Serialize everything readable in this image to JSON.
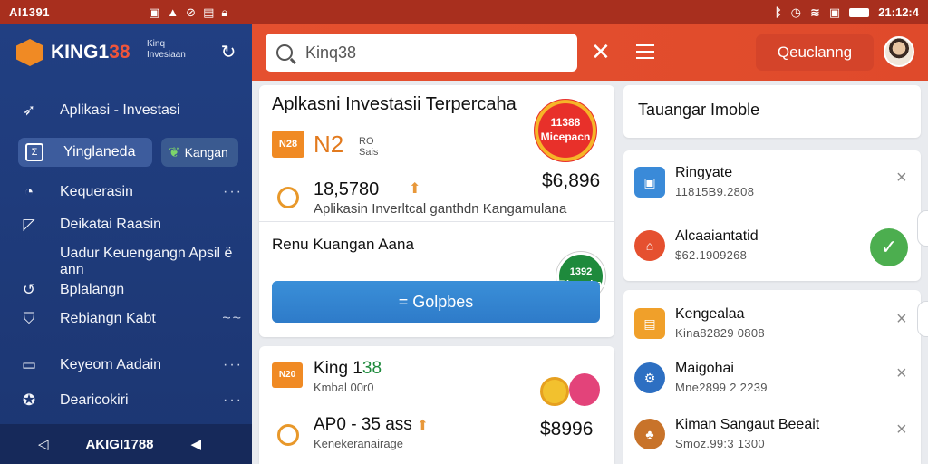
{
  "status_bar": {
    "left": "AI1391",
    "mid_icons": [
      "image-icon",
      "upload-icon",
      "link-icon",
      "sim-icon",
      "lock-icon"
    ],
    "right": "21:12:4"
  },
  "sidebar": {
    "brand_name_a": "KING1",
    "brand_name_b": "38",
    "brand_tag": "Kinq\nInvesiaan",
    "items": [
      {
        "label": "Aplikasi - Investasi",
        "icon": "compass-icon"
      },
      {
        "label": "Kequerasin",
        "icon": "clock-icon",
        "more": "···"
      },
      {
        "label": "Deikatai Raasin",
        "icon": "chart-icon"
      },
      {
        "label": "Bplalangn",
        "icon": "refresh-icon"
      },
      {
        "label": "Rebiangn Kabt",
        "icon": "shield-icon",
        "more": "~~"
      },
      {
        "label": "Keyeom Aadain",
        "icon": "wallet-icon",
        "more": "···"
      },
      {
        "label": "Dearicokiri",
        "icon": "star-icon",
        "more": "···"
      }
    ],
    "subline": "Uadur Keuengangn Apsil ë ann",
    "active_pill": "Yinglaneda",
    "green_pill": "Kangan",
    "bottom_label": "AKIGI1788"
  },
  "header": {
    "search_value": "Kinq38",
    "search_placeholder": "Search",
    "action_button": "Qeuclanng"
  },
  "main_card": {
    "title": "Aplkasni Investasii Terpercaha",
    "badge_line1": "11388",
    "badge_line2": "Micepacn",
    "thumb_text": "N28",
    "code": "N2",
    "code_sub": "RO\nSais",
    "price": "$6,896",
    "stat_value": "18,5780",
    "stat_desc": "Aplikasin Inverltcal ganthdn Kangamulana",
    "section_title": "Renu Kuangan Aana",
    "green_badge_line1": "1392",
    "green_badge_line2": "Rbnoahal",
    "button_label": "= Golpbes"
  },
  "second_card": {
    "thumb_text": "N20",
    "name_a": "King 1",
    "name_b": "38",
    "sub": "Kmbal 00r0",
    "stat": "AP0 - 35 ass",
    "stat_sub": "Kenekeranairage",
    "price": "$8996"
  },
  "right_panel": {
    "title": "Tauangar Imoble",
    "card1": [
      {
        "name": "Ringyate",
        "meta": "11815B9.2808",
        "icon": "folder-icon",
        "color": "#3a8ad8",
        "close": "×"
      },
      {
        "name": "Alcaaiantatid",
        "meta": "$62.1909268",
        "icon": "bag-icon",
        "color": "#e5502f"
      }
    ],
    "card2": [
      {
        "name": "Kengealaa",
        "meta": "Kina82829 0808",
        "icon": "ticket-icon",
        "color": "#f0a02a",
        "close": "×"
      },
      {
        "name": "Maigohai",
        "meta": "Mne2899 2 2239",
        "icon": "gear-icon",
        "color": "#2d6fc2",
        "close": "×"
      },
      {
        "name": "Kiman Sangaut Beeait",
        "meta": "Smoz.99:3 1300",
        "icon": "basket-icon",
        "color": "#c8732a",
        "close": "×"
      }
    ],
    "check_icon": "✓"
  }
}
